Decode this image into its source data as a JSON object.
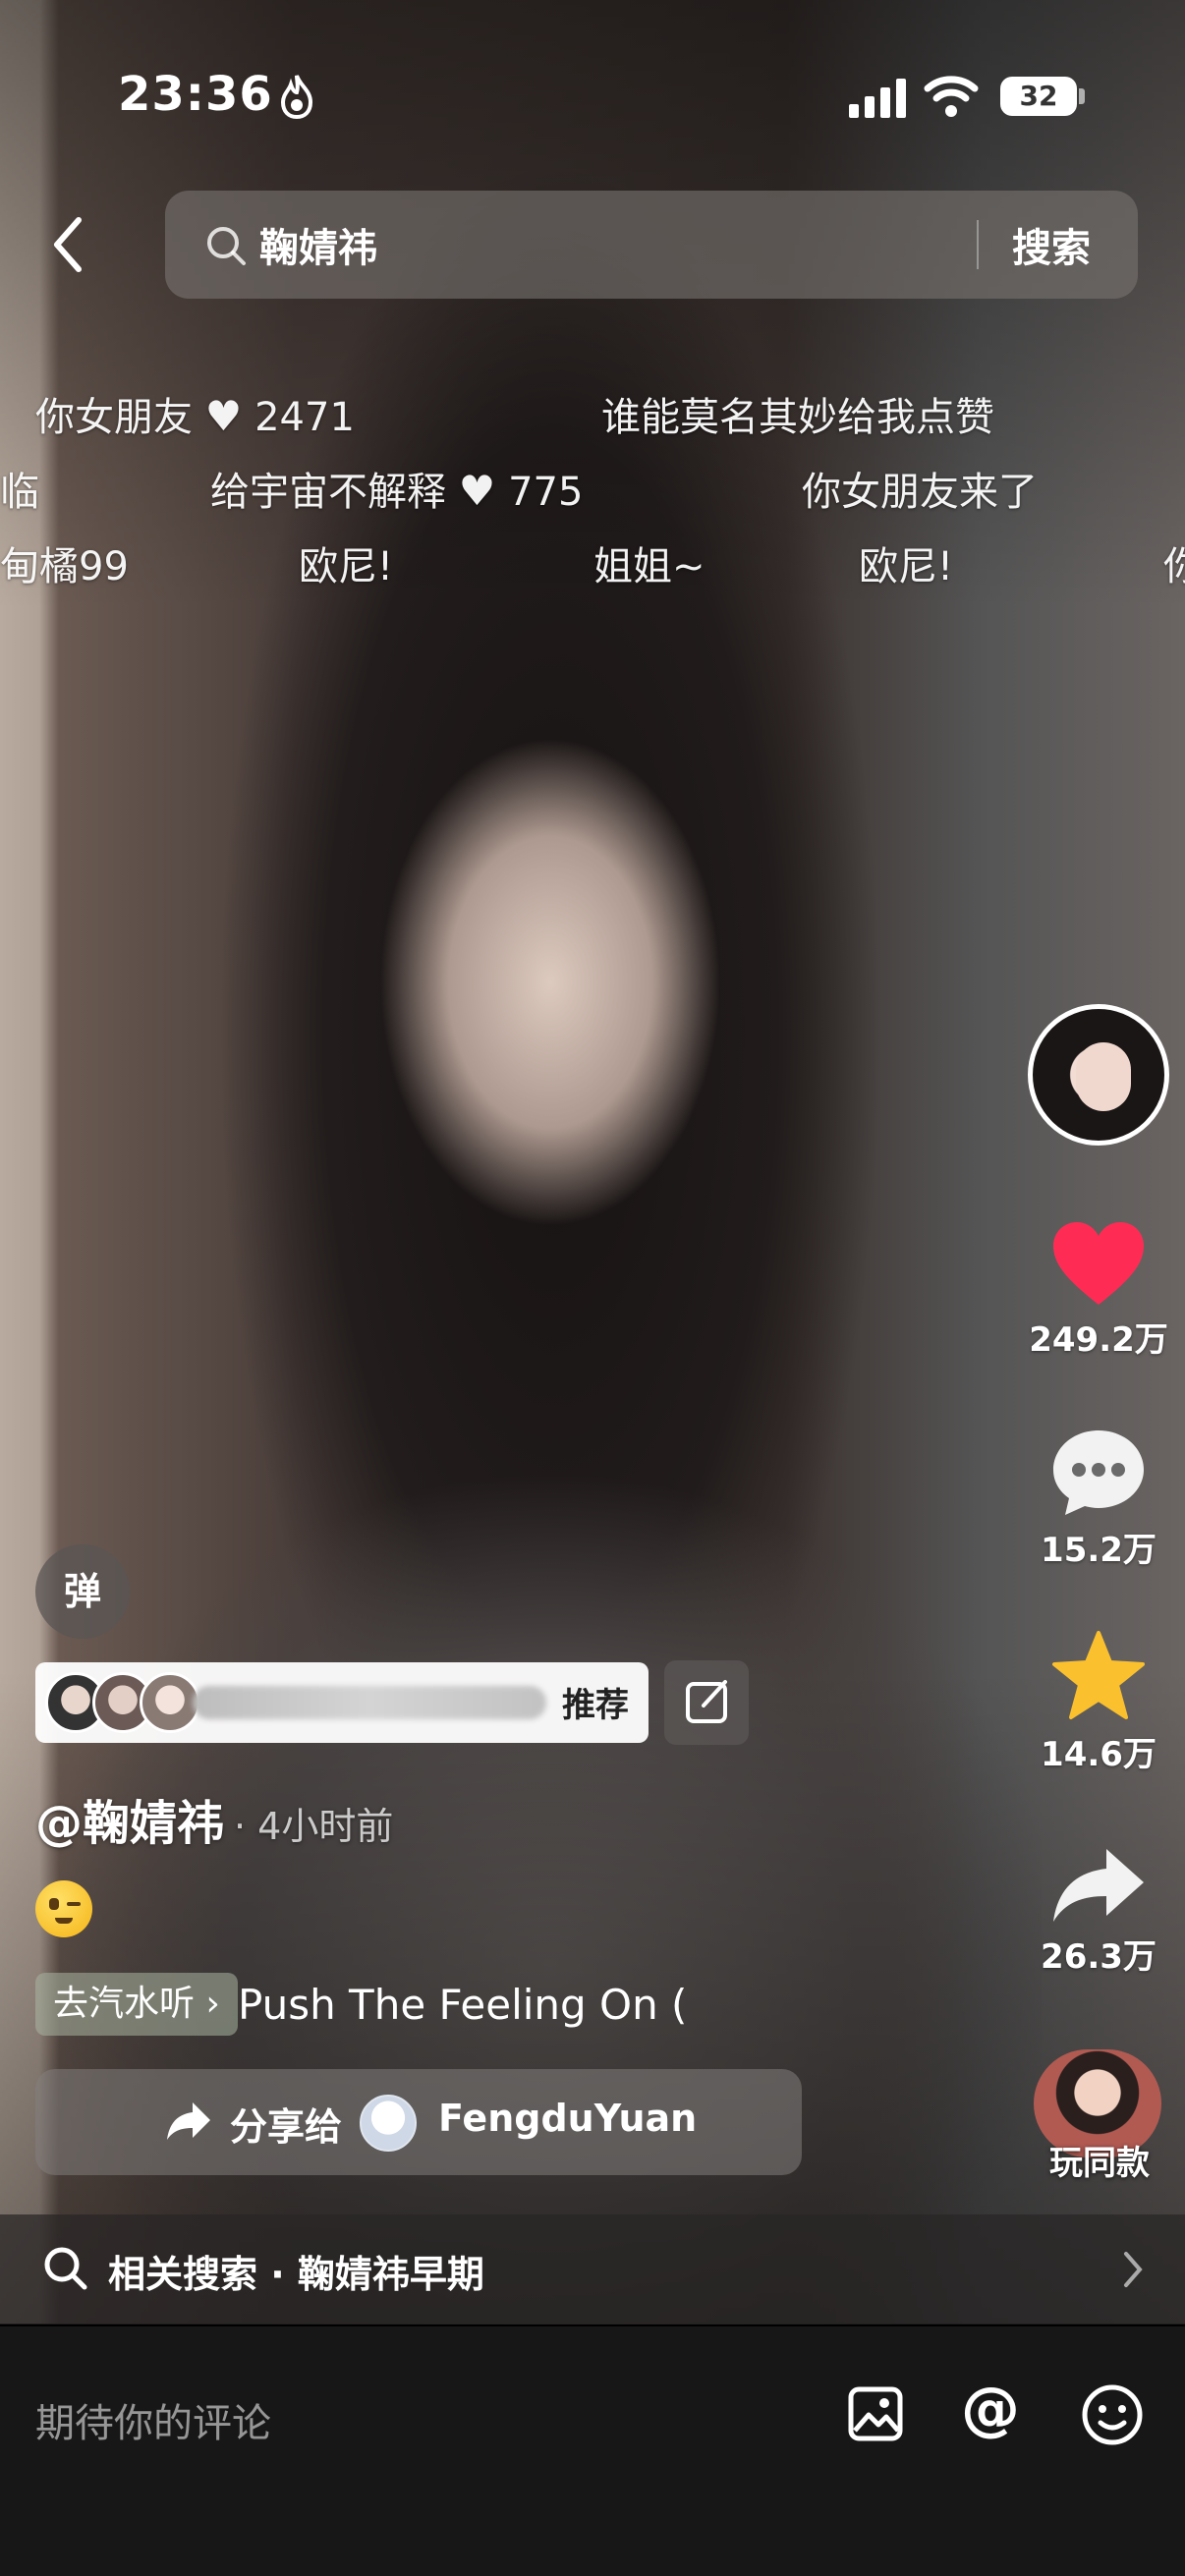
{
  "status_bar": {
    "time": "23:36",
    "battery": "32"
  },
  "search": {
    "query": "鞠婧祎",
    "button_label": "搜索"
  },
  "danmaku": [
    {
      "text": "你女朋友",
      "likes": "2471"
    },
    {
      "text": "谁能莫名其妙给我点赞"
    },
    {
      "text": "临"
    },
    {
      "text": "给宇宙不解释",
      "likes": "775"
    },
    {
      "text": "你女朋友来了"
    },
    {
      "text": "甸橘99"
    },
    {
      "text": "欧尼!"
    },
    {
      "text": "姐姐~"
    },
    {
      "text": "欧尼!"
    },
    {
      "text": "你"
    }
  ],
  "actions": {
    "likes": "249.2万",
    "comments": "15.2万",
    "favorites": "14.6万",
    "shares": "26.3万",
    "try_same_label": "玩同款",
    "colors": {
      "like": "#fe2c55",
      "favorite": "#fbc02d"
    }
  },
  "post": {
    "danmaku_toggle_label": "弹",
    "recommend_label": "推荐",
    "author": "@鞠婧祎",
    "time": "· 4小时前",
    "music_prefix": "去汽水听 ›",
    "music_title": "Push The Feeling On (",
    "share_label": "分享给",
    "share_target": "FengduYuan"
  },
  "related_search": {
    "text": "相关搜索 · 鞠婧祎早期"
  },
  "comment_bar": {
    "placeholder": "期待你的评论",
    "at_symbol": "@"
  },
  "icons": [
    "flame-icon",
    "signal-icon",
    "wifi-icon",
    "back-icon",
    "search-icon",
    "heart-icon",
    "comment-bubble-icon",
    "star-icon",
    "share-arrow-icon",
    "edit-icon",
    "wink-emoji-icon",
    "chevron-right-icon",
    "image-icon",
    "smile-icon"
  ]
}
